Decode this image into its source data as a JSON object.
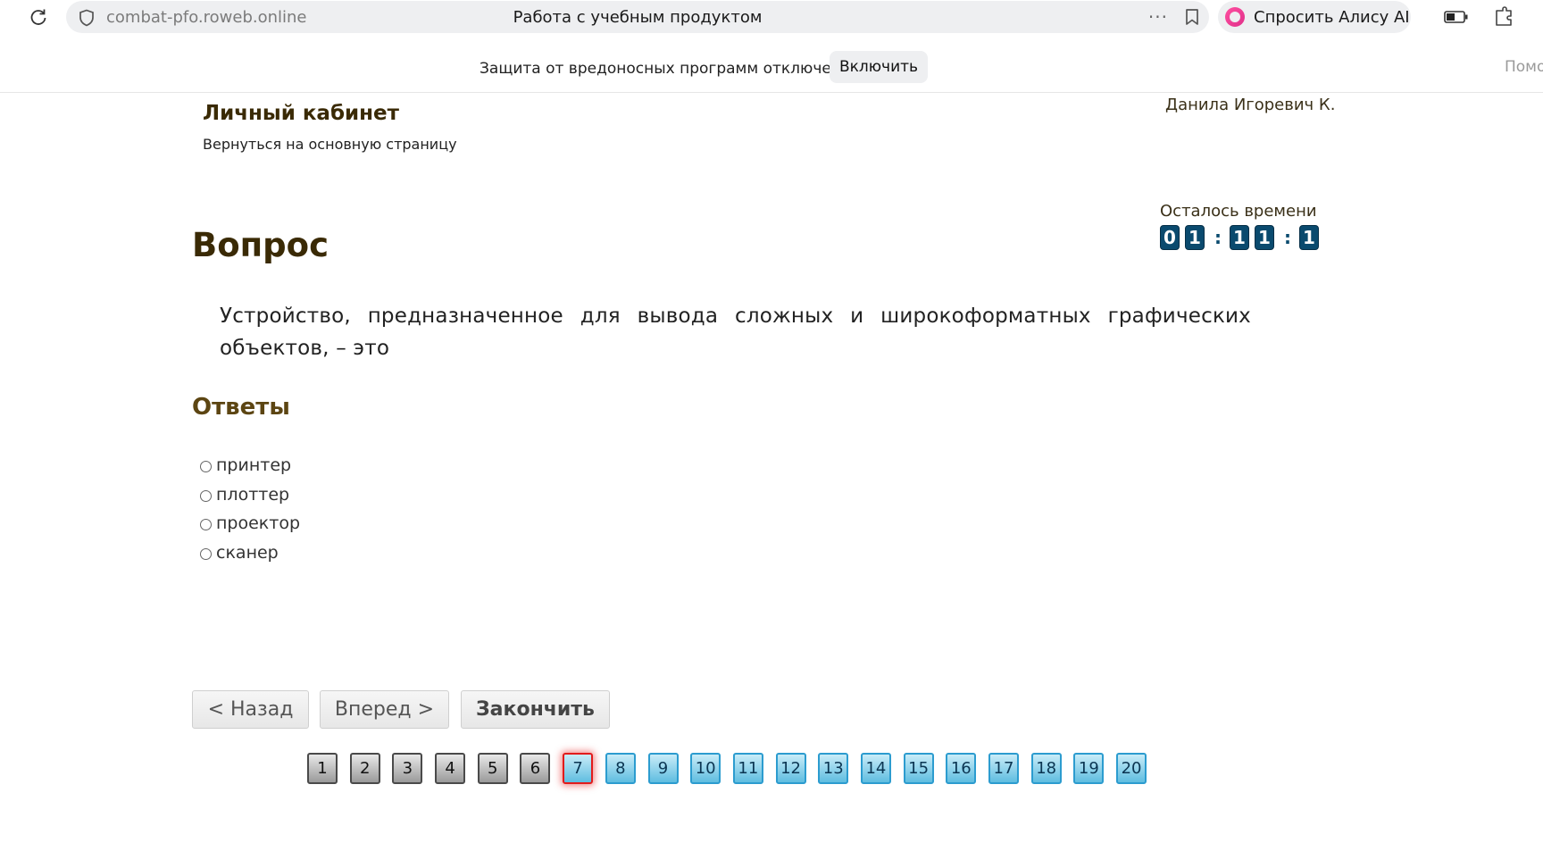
{
  "browser": {
    "url": "combat-pfo.roweb.online",
    "tab_title": "Работа с учебным продуктом",
    "more_icon": "···",
    "alice_label": "Спросить Алису AI"
  },
  "protection": {
    "text": "Защита от вредоносных программ отключена",
    "enable_button": "Включить",
    "help_cut": "Помо"
  },
  "header": {
    "title": "Личный кабинет",
    "back_link": "Вернуться на основную страницу",
    "user_name": "Данила Игоревич К."
  },
  "timer": {
    "label": "Осталось времени",
    "d1": "0",
    "d2": "1",
    "d3": "1",
    "d4": "1",
    "d5": "1",
    "sep": ":"
  },
  "question": {
    "heading": "Вопрос",
    "text": "Устройство, предназначенное для вывода сложных и широкоформатных графических объектов, – это"
  },
  "answers": {
    "heading": "Ответы",
    "options": [
      "принтер",
      "плоттер",
      "проектор",
      "сканер"
    ]
  },
  "nav": {
    "back": "< Назад",
    "next": "Вперед >",
    "finish": "Закончить"
  },
  "pager": {
    "current": 7,
    "pages": [
      "1",
      "2",
      "3",
      "4",
      "5",
      "6",
      "7",
      "8",
      "9",
      "10",
      "11",
      "12",
      "13",
      "14",
      "15",
      "16",
      "17",
      "18",
      "19",
      "20"
    ]
  },
  "colors": {
    "accent_dark": "#0a4a6e",
    "current_border": "#e21b1b",
    "todo": "#5fbde0"
  }
}
